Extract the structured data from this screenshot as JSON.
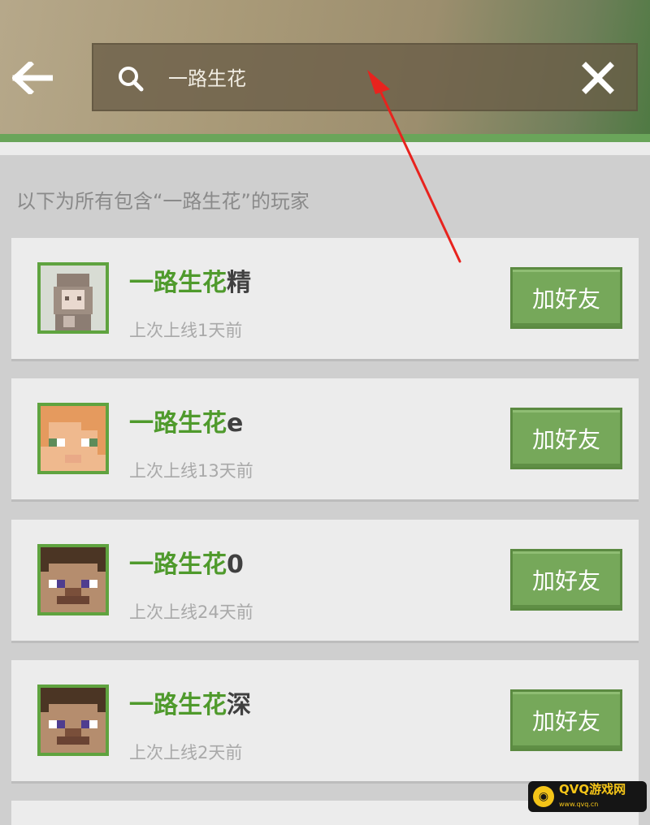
{
  "search": {
    "query": "一路生花"
  },
  "results": {
    "caption": "以下为所有包含“一路生花”的玩家"
  },
  "players": [
    {
      "highlight": "一路生花",
      "suffix": "精",
      "last_online": "上次上线1天前",
      "add_label": "加好友",
      "avatar": "anime-skin"
    },
    {
      "highlight": "一路生花",
      "suffix": "e",
      "last_online": "上次上线13天前",
      "add_label": "加好友",
      "avatar": "alex-skin"
    },
    {
      "highlight": "一路生花",
      "suffix": "0",
      "last_online": "上次上线24天前",
      "add_label": "加好友",
      "avatar": "steve-skin"
    },
    {
      "highlight": "一路生花",
      "suffix": "深",
      "last_online": "上次上线2天前",
      "add_label": "加好友",
      "avatar": "steve-skin"
    }
  ],
  "watermark": {
    "text": "QVQ游戏网",
    "sub": "www.qvq.cn"
  },
  "colors": {
    "accent": "#4f9a2c",
    "button": "#76a85a",
    "avatar_border": "#5fa33f",
    "annotation_arrow": "#e8231e"
  }
}
